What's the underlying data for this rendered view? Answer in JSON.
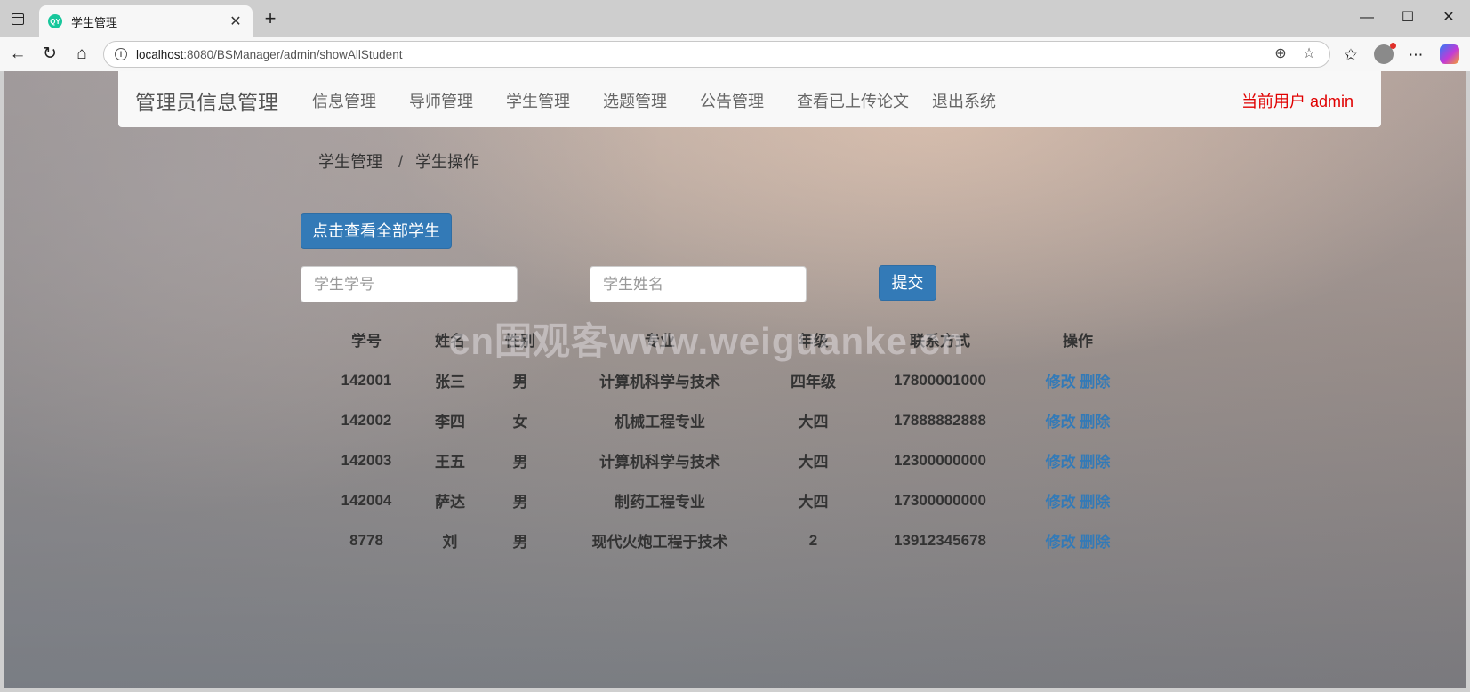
{
  "browser": {
    "tab_title": "学生管理",
    "favicon_text": "QY",
    "url_host": "localhost",
    "url_rest": ":8080/BSManager/admin/showAllStudent"
  },
  "navbar": {
    "brand": "管理员信息管理",
    "items": [
      "信息管理",
      "导师管理",
      "学生管理",
      "选题管理",
      "公告管理",
      "查看已上传论文",
      "退出系统"
    ],
    "current_user": "当前用户 admin"
  },
  "breadcrumb": {
    "parent": "学生管理",
    "separator": "/",
    "current": "学生操作"
  },
  "actions": {
    "show_all": "点击查看全部学生",
    "submit": "提交"
  },
  "search": {
    "id_placeholder": "学生学号",
    "name_placeholder": "学生姓名"
  },
  "watermark": "cn围观客www.weiguanke.cn",
  "table": {
    "headers": [
      "学号",
      "姓名",
      "性别",
      "专业",
      "年级",
      "联系方式",
      "操作"
    ],
    "edit_label": "修改",
    "delete_label": "删除",
    "rows": [
      {
        "id": "142001",
        "name": "张三",
        "sex": "男",
        "major": "计算机科学与技术",
        "grade": "四年级",
        "phone": "17800001000"
      },
      {
        "id": "142002",
        "name": "李四",
        "sex": "女",
        "major": "机械工程专业",
        "grade": "大四",
        "phone": "17888882888"
      },
      {
        "id": "142003",
        "name": "王五",
        "sex": "男",
        "major": "计算机科学与技术",
        "grade": "大四",
        "phone": "12300000000"
      },
      {
        "id": "142004",
        "name": "萨达",
        "sex": "男",
        "major": "制药工程专业",
        "grade": "大四",
        "phone": "17300000000"
      },
      {
        "id": "8778",
        "name": "刘",
        "sex": "男",
        "major": "现代火炮工程于技术",
        "grade": "2",
        "phone": "13912345678"
      }
    ]
  }
}
